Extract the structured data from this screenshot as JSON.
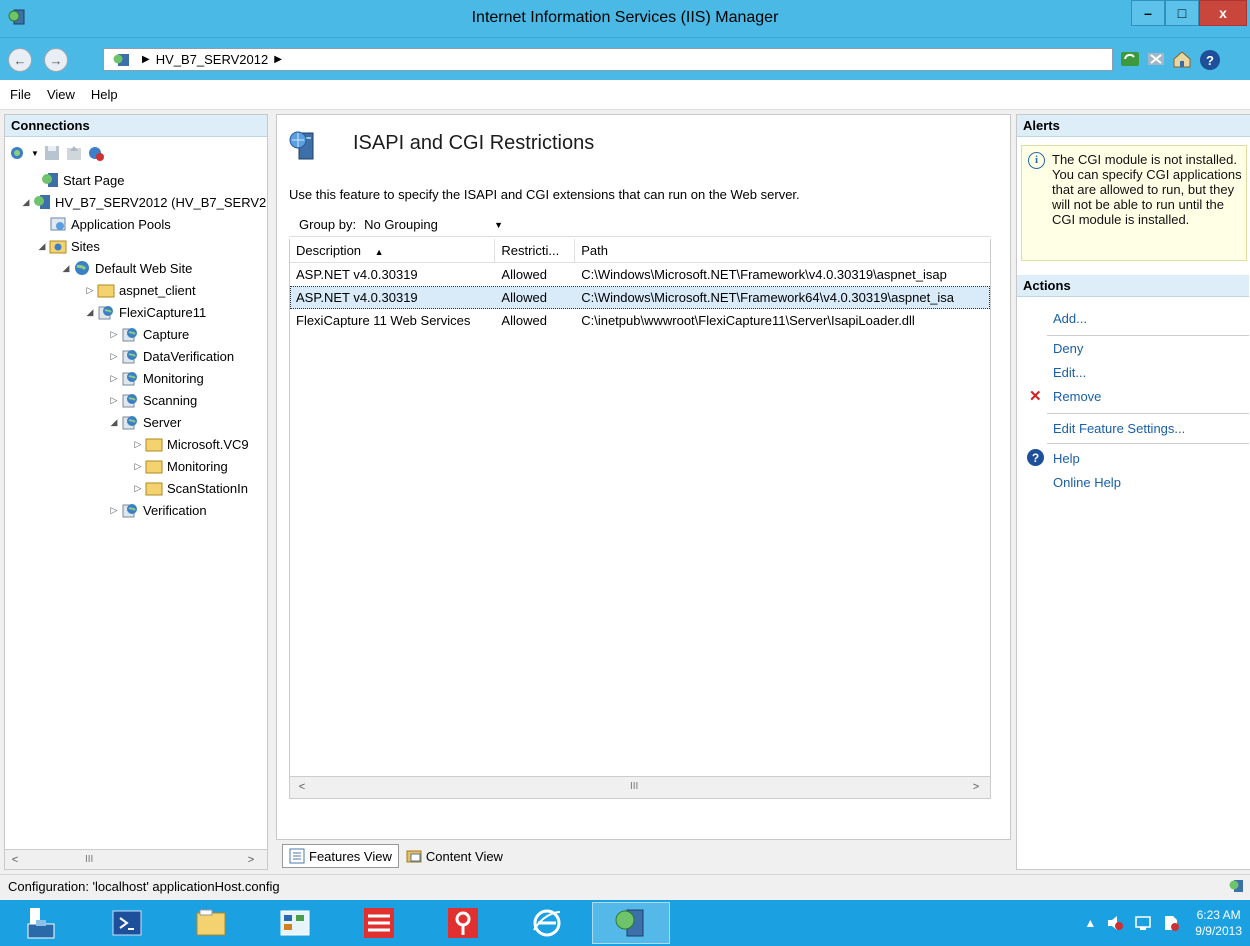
{
  "window": {
    "title": "Internet Information Services (IIS) Manager",
    "min_glyph": "–",
    "max_glyph": "□",
    "close_glyph": "x"
  },
  "address": {
    "back_glyph": "←",
    "fwd_glyph": "→",
    "breadcrumb": [
      "HV_B7_SERV2012"
    ],
    "arrow": "▶",
    "help_glyph": "?"
  },
  "menu": [
    "File",
    "View",
    "Help"
  ],
  "connections": {
    "header": "Connections",
    "tree": [
      {
        "label": "Start Page",
        "icon": "server-icon",
        "expander": ""
      },
      {
        "label": "HV_B7_SERV2012 (HV_B7_SERV2",
        "icon": "server-icon",
        "expander": "◢"
      },
      {
        "label": "Application Pools",
        "icon": "app-pool-icon",
        "expander": ""
      },
      {
        "label": "Sites",
        "icon": "sites-folder-icon",
        "expander": "◢"
      },
      {
        "label": "Default Web Site",
        "icon": "globe-icon",
        "expander": "◢"
      },
      {
        "label": "aspnet_client",
        "icon": "folder-icon",
        "expander": "▷"
      },
      {
        "label": "FlexiCapture11",
        "icon": "web-app-icon",
        "expander": "◢"
      },
      {
        "label": "Capture",
        "icon": "web-app-icon",
        "expander": "▷"
      },
      {
        "label": "DataVerification",
        "icon": "web-app-icon",
        "expander": "▷"
      },
      {
        "label": "Monitoring",
        "icon": "web-app-icon",
        "expander": "▷"
      },
      {
        "label": "Scanning",
        "icon": "web-app-icon",
        "expander": "▷"
      },
      {
        "label": "Server",
        "icon": "web-app-icon",
        "expander": "◢"
      },
      {
        "label": "Microsoft.VC9",
        "icon": "folder-icon",
        "expander": "▷"
      },
      {
        "label": "Monitoring",
        "icon": "folder-icon",
        "expander": "▷"
      },
      {
        "label": "ScanStationIn",
        "icon": "folder-icon",
        "expander": "▷"
      },
      {
        "label": "Verification",
        "icon": "web-app-icon",
        "expander": "▷"
      }
    ],
    "scroll_left": "<",
    "scroll_right": ">",
    "scroll_mark": "III"
  },
  "feature": {
    "title": "ISAPI and CGI Restrictions",
    "description": "Use this feature to specify the ISAPI and CGI extensions that can run on the Web server.",
    "group_by_label": "Group by:",
    "group_by_value": "No Grouping",
    "dropdown_glyph": "▼",
    "sort_glyph": "▲",
    "columns": [
      "Description",
      "Restricti...",
      "Path"
    ],
    "rows": [
      {
        "description": "ASP.NET v4.0.30319",
        "restriction": "Allowed",
        "path": "C:\\Windows\\Microsoft.NET\\Framework\\v4.0.30319\\aspnet_isap",
        "selected": false
      },
      {
        "description": "ASP.NET v4.0.30319",
        "restriction": "Allowed",
        "path": "C:\\Windows\\Microsoft.NET\\Framework64\\v4.0.30319\\aspnet_isa",
        "selected": true
      },
      {
        "description": "FlexiCapture 11 Web Services",
        "restriction": "Allowed",
        "path": "C:\\inetpub\\wwwroot\\FlexiCapture11\\Server\\IsapiLoader.dll",
        "selected": false
      }
    ],
    "scroll_left": "<",
    "scroll_right": ">",
    "scroll_mark": "III"
  },
  "view_tabs": [
    "Features View",
    "Content View"
  ],
  "alerts": {
    "header": "Alerts",
    "icon_glyph": "i",
    "message": "The CGI module is not installed. You can specify CGI applications that are allowed to run, but they will not be able to run until the CGI module is installed."
  },
  "actions": {
    "header": "Actions",
    "add": "Add...",
    "deny": "Deny",
    "edit": "Edit...",
    "remove": "Remove",
    "remove_glyph": "✕",
    "edit_feature_settings": "Edit Feature Settings...",
    "help": "Help",
    "help_glyph": "?",
    "online_help": "Online Help"
  },
  "status": {
    "text": "Configuration: 'localhost' applicationHost.config"
  },
  "taskbar": {
    "time": "6:23 AM",
    "date": "9/9/2013",
    "tray_arrow": "▲",
    "colors": {
      "taskbar": "#1ba1e2",
      "titlebar": "#4bb9e6",
      "link": "#1a5fa8"
    }
  }
}
